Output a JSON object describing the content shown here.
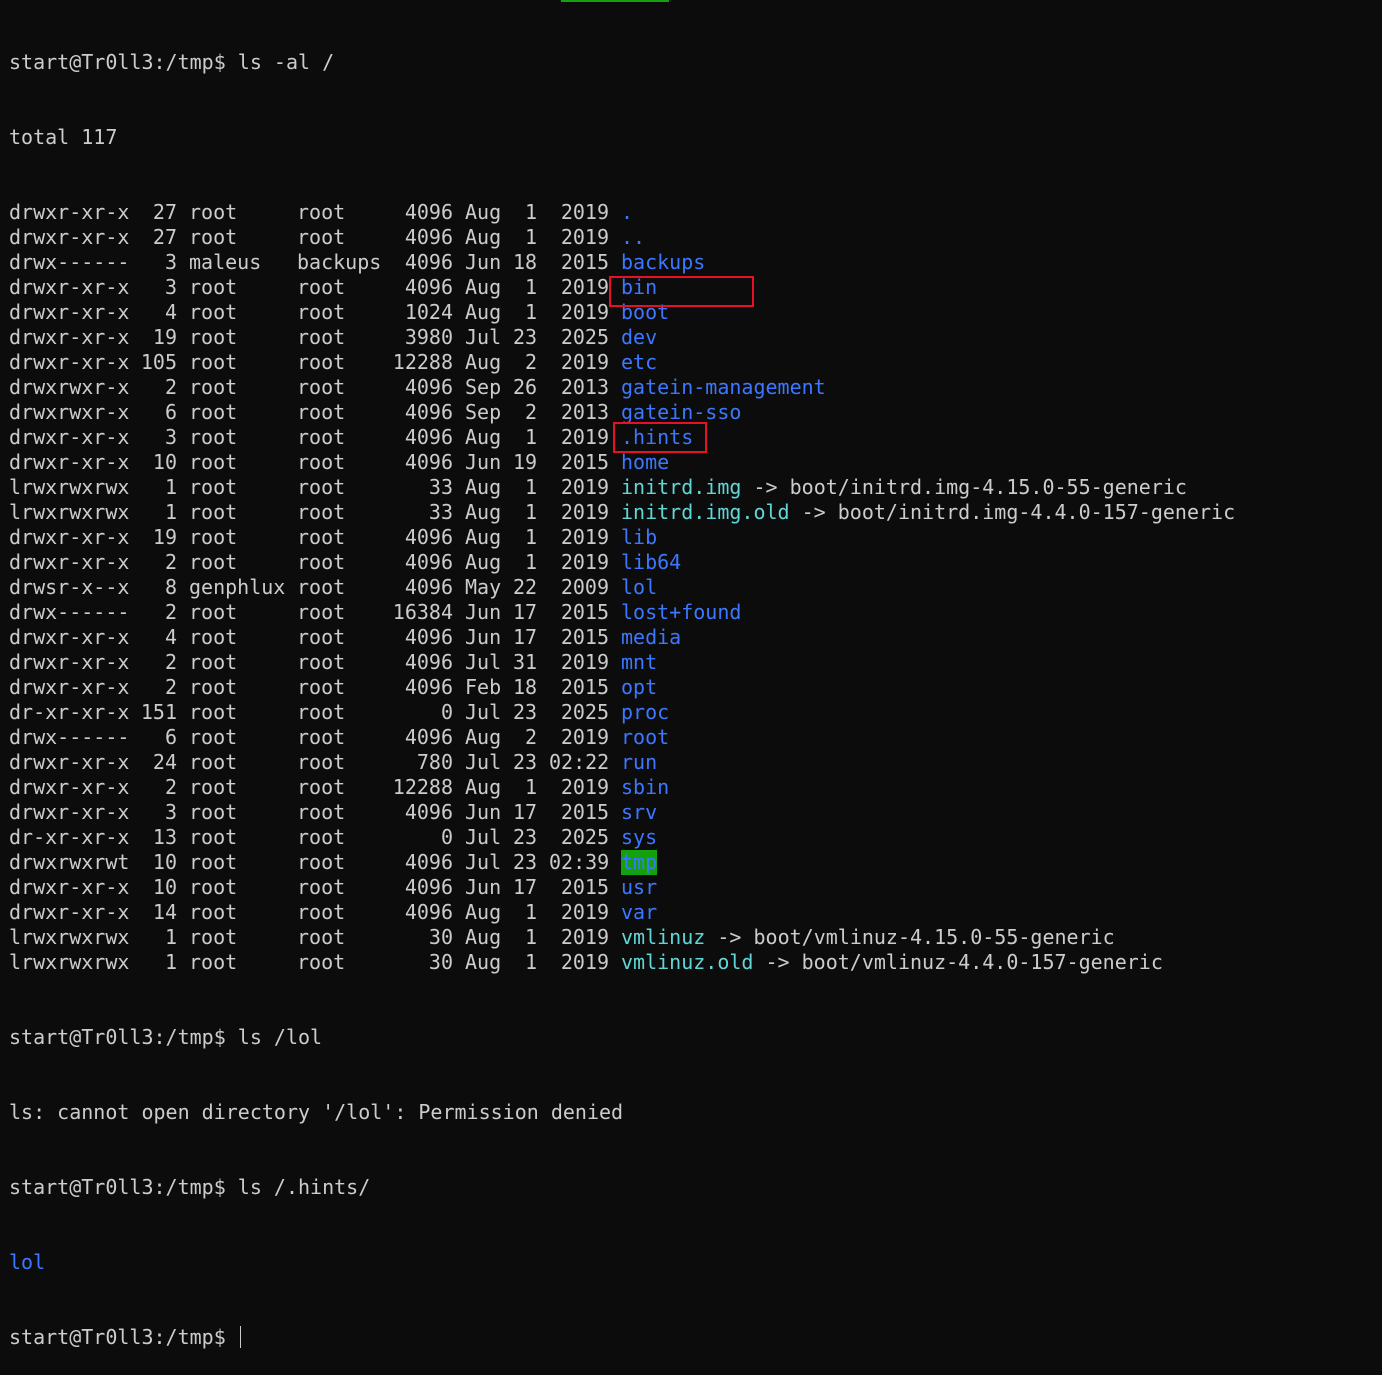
{
  "prompt": "start@Tr0ll3:/tmp$",
  "commands": {
    "first": "ls -al /",
    "second": "ls /lol",
    "third": "ls /.hints/"
  },
  "total_line": "total 117",
  "entries": [
    {
      "perm": "drwxr-xr-x",
      "links": "27",
      "owner": "root",
      "group": "root",
      "size": "4096",
      "month": "Aug",
      "day": "1",
      "ytime": "2019",
      "name": ".",
      "type": "dir",
      "target": ""
    },
    {
      "perm": "drwxr-xr-x",
      "links": "27",
      "owner": "root",
      "group": "root",
      "size": "4096",
      "month": "Aug",
      "day": "1",
      "ytime": "2019",
      "name": "..",
      "type": "dir",
      "target": ""
    },
    {
      "perm": "drwx------",
      "links": "3",
      "owner": "maleus",
      "group": "backups",
      "size": "4096",
      "month": "Jun",
      "day": "18",
      "ytime": "2015",
      "name": "backups",
      "type": "dir",
      "target": ""
    },
    {
      "perm": "drwxr-xr-x",
      "links": "3",
      "owner": "root",
      "group": "root",
      "size": "4096",
      "month": "Aug",
      "day": "1",
      "ytime": "2019",
      "name": "bin",
      "type": "dir",
      "target": ""
    },
    {
      "perm": "drwxr-xr-x",
      "links": "4",
      "owner": "root",
      "group": "root",
      "size": "1024",
      "month": "Aug",
      "day": "1",
      "ytime": "2019",
      "name": "boot",
      "type": "dir",
      "target": ""
    },
    {
      "perm": "drwxr-xr-x",
      "links": "19",
      "owner": "root",
      "group": "root",
      "size": "3980",
      "month": "Jul",
      "day": "23",
      "ytime": "2025",
      "name": "dev",
      "type": "dir",
      "target": ""
    },
    {
      "perm": "drwxr-xr-x",
      "links": "105",
      "owner": "root",
      "group": "root",
      "size": "12288",
      "month": "Aug",
      "day": "2",
      "ytime": "2019",
      "name": "etc",
      "type": "dir",
      "target": ""
    },
    {
      "perm": "drwxrwxr-x",
      "links": "2",
      "owner": "root",
      "group": "root",
      "size": "4096",
      "month": "Sep",
      "day": "26",
      "ytime": "2013",
      "name": "gatein-management",
      "type": "dir",
      "target": ""
    },
    {
      "perm": "drwxrwxr-x",
      "links": "6",
      "owner": "root",
      "group": "root",
      "size": "4096",
      "month": "Sep",
      "day": "2",
      "ytime": "2013",
      "name": "gatein-sso",
      "type": "dir",
      "target": ""
    },
    {
      "perm": "drwxr-xr-x",
      "links": "3",
      "owner": "root",
      "group": "root",
      "size": "4096",
      "month": "Aug",
      "day": "1",
      "ytime": "2019",
      "name": ".hints",
      "type": "dir",
      "target": ""
    },
    {
      "perm": "drwxr-xr-x",
      "links": "10",
      "owner": "root",
      "group": "root",
      "size": "4096",
      "month": "Jun",
      "day": "19",
      "ytime": "2015",
      "name": "home",
      "type": "dir",
      "target": ""
    },
    {
      "perm": "lrwxrwxrwx",
      "links": "1",
      "owner": "root",
      "group": "root",
      "size": "33",
      "month": "Aug",
      "day": "1",
      "ytime": "2019",
      "name": "initrd.img",
      "type": "link",
      "target": "boot/initrd.img-4.15.0-55-generic"
    },
    {
      "perm": "lrwxrwxrwx",
      "links": "1",
      "owner": "root",
      "group": "root",
      "size": "33",
      "month": "Aug",
      "day": "1",
      "ytime": "2019",
      "name": "initrd.img.old",
      "type": "link",
      "target": "boot/initrd.img-4.4.0-157-generic"
    },
    {
      "perm": "drwxr-xr-x",
      "links": "19",
      "owner": "root",
      "group": "root",
      "size": "4096",
      "month": "Aug",
      "day": "1",
      "ytime": "2019",
      "name": "lib",
      "type": "dir",
      "target": ""
    },
    {
      "perm": "drwxr-xr-x",
      "links": "2",
      "owner": "root",
      "group": "root",
      "size": "4096",
      "month": "Aug",
      "day": "1",
      "ytime": "2019",
      "name": "lib64",
      "type": "dir",
      "target": ""
    },
    {
      "perm": "drwsr-x--x",
      "links": "8",
      "owner": "genphlux",
      "group": "root",
      "size": "4096",
      "month": "May",
      "day": "22",
      "ytime": "2009",
      "name": "lol",
      "type": "dir",
      "target": ""
    },
    {
      "perm": "drwx------",
      "links": "2",
      "owner": "root",
      "group": "root",
      "size": "16384",
      "month": "Jun",
      "day": "17",
      "ytime": "2015",
      "name": "lost+found",
      "type": "dir",
      "target": ""
    },
    {
      "perm": "drwxr-xr-x",
      "links": "4",
      "owner": "root",
      "group": "root",
      "size": "4096",
      "month": "Jun",
      "day": "17",
      "ytime": "2015",
      "name": "media",
      "type": "dir",
      "target": ""
    },
    {
      "perm": "drwxr-xr-x",
      "links": "2",
      "owner": "root",
      "group": "root",
      "size": "4096",
      "month": "Jul",
      "day": "31",
      "ytime": "2019",
      "name": "mnt",
      "type": "dir",
      "target": ""
    },
    {
      "perm": "drwxr-xr-x",
      "links": "2",
      "owner": "root",
      "group": "root",
      "size": "4096",
      "month": "Feb",
      "day": "18",
      "ytime": "2015",
      "name": "opt",
      "type": "dir",
      "target": ""
    },
    {
      "perm": "dr-xr-xr-x",
      "links": "151",
      "owner": "root",
      "group": "root",
      "size": "0",
      "month": "Jul",
      "day": "23",
      "ytime": "2025",
      "name": "proc",
      "type": "dir",
      "target": ""
    },
    {
      "perm": "drwx------",
      "links": "6",
      "owner": "root",
      "group": "root",
      "size": "4096",
      "month": "Aug",
      "day": "2",
      "ytime": "2019",
      "name": "root",
      "type": "dir",
      "target": ""
    },
    {
      "perm": "drwxr-xr-x",
      "links": "24",
      "owner": "root",
      "group": "root",
      "size": "780",
      "month": "Jul",
      "day": "23",
      "ytime": "02:22",
      "name": "run",
      "type": "dir",
      "target": ""
    },
    {
      "perm": "drwxr-xr-x",
      "links": "2",
      "owner": "root",
      "group": "root",
      "size": "12288",
      "month": "Aug",
      "day": "1",
      "ytime": "2019",
      "name": "sbin",
      "type": "dir",
      "target": ""
    },
    {
      "perm": "drwxr-xr-x",
      "links": "3",
      "owner": "root",
      "group": "root",
      "size": "4096",
      "month": "Jun",
      "day": "17",
      "ytime": "2015",
      "name": "srv",
      "type": "dir",
      "target": ""
    },
    {
      "perm": "dr-xr-xr-x",
      "links": "13",
      "owner": "root",
      "group": "root",
      "size": "0",
      "month": "Jul",
      "day": "23",
      "ytime": "2025",
      "name": "sys",
      "type": "dir",
      "target": ""
    },
    {
      "perm": "drwxrwxrwt",
      "links": "10",
      "owner": "root",
      "group": "root",
      "size": "4096",
      "month": "Jul",
      "day": "23",
      "ytime": "02:39",
      "name": "tmp",
      "type": "sticky",
      "target": ""
    },
    {
      "perm": "drwxr-xr-x",
      "links": "10",
      "owner": "root",
      "group": "root",
      "size": "4096",
      "month": "Jun",
      "day": "17",
      "ytime": "2015",
      "name": "usr",
      "type": "dir",
      "target": ""
    },
    {
      "perm": "drwxr-xr-x",
      "links": "14",
      "owner": "root",
      "group": "root",
      "size": "4096",
      "month": "Aug",
      "day": "1",
      "ytime": "2019",
      "name": "var",
      "type": "dir",
      "target": ""
    },
    {
      "perm": "lrwxrwxrwx",
      "links": "1",
      "owner": "root",
      "group": "root",
      "size": "30",
      "month": "Aug",
      "day": "1",
      "ytime": "2019",
      "name": "vmlinuz",
      "type": "link",
      "target": "boot/vmlinuz-4.15.0-55-generic"
    },
    {
      "perm": "lrwxrwxrwx",
      "links": "1",
      "owner": "root",
      "group": "root",
      "size": "30",
      "month": "Aug",
      "day": "1",
      "ytime": "2019",
      "name": "vmlinuz.old",
      "type": "link",
      "target": "boot/vmlinuz-4.4.0-157-generic"
    }
  ],
  "link_arrow": "->",
  "error_line": "ls: cannot open directory '/lol': Permission denied",
  "hints_output": "lol",
  "colors": {
    "background": "#0c0c0c",
    "text": "#cccccc",
    "directory": "#3b78ff",
    "symlink": "#61d6d6",
    "sticky_bg": "#13a10e",
    "highlight_box": "#e81123"
  },
  "highlighted_entries": [
    ".hints",
    "lol"
  ]
}
